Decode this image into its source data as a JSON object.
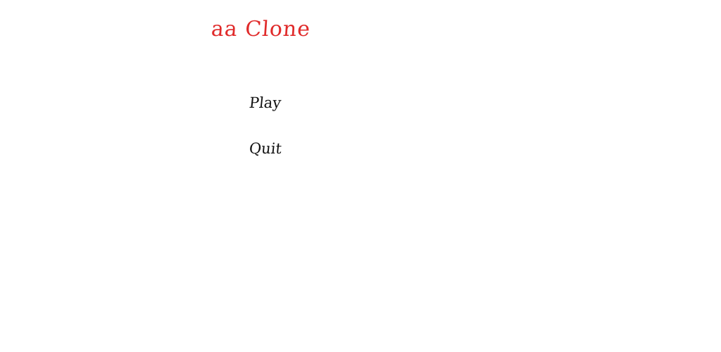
{
  "title": "aa Clone",
  "menu": {
    "play_label": "Play",
    "quit_label": "Quit"
  },
  "colors": {
    "title": "#e02a2a",
    "menu_text": "#111111",
    "background": "#ffffff"
  }
}
